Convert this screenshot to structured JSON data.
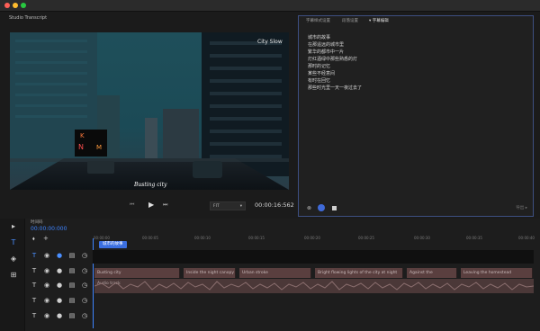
{
  "window": {
    "tab_label": "Studio Transcript",
    "dot_colors": [
      "#fe5f57",
      "#febc2e",
      "#28c840"
    ]
  },
  "preview": {
    "watermark": "City Slow",
    "subtitle": "Busting city",
    "sign_letters": [
      "K",
      "M",
      "N"
    ]
  },
  "controls": {
    "zoom": "FIT",
    "timecode": "00:00:16:562"
  },
  "right_panel": {
    "tabs": [
      "字幕样式设置",
      "段落设置",
      "▾ 字幕编辑"
    ],
    "lines": [
      "城市的故事",
      "在那遥远的城市里",
      "繁华的都市中一片",
      "灯红酒绿中那些熟悉的灯",
      "那时的记忆",
      "某些不经意间",
      "有时在回忆",
      "那些时光里一天一夜过去了"
    ],
    "footer_right": "导出 ▸"
  },
  "left_tools": [
    "▸",
    "T",
    "◈",
    "⊞"
  ],
  "timeline": {
    "timecode_label": "时间码",
    "timecode": "00:00:00:000",
    "ticks": [
      "00:00:00",
      "00:00:05",
      "00:00:10",
      "00:00:15",
      "00:00:20",
      "00:00:25",
      "00:00:30",
      "00:00:35",
      "00:00:40",
      "00:00:45",
      "00:00:50"
    ],
    "playhead_label": "城市的故事",
    "clips": [
      {
        "label": "Busting city"
      },
      {
        "label": "Inside the night canopy"
      },
      {
        "label": "Urban stroke"
      },
      {
        "label": "Bright flowing lights of the city at night"
      },
      {
        "label": "Against the"
      },
      {
        "label": "Leaving the homestead"
      }
    ],
    "audio_label": "Audio track"
  }
}
